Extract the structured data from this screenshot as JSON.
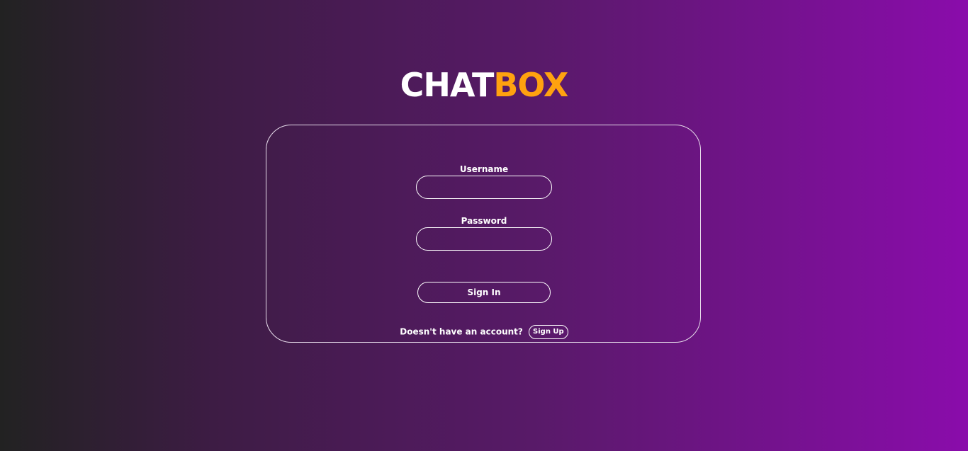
{
  "logo": {
    "part1": "CHAT",
    "part2": "BOX"
  },
  "colors": {
    "accent": "#ffa20f",
    "gradient_start": "#222222",
    "gradient_end": "#8a0cab"
  },
  "form": {
    "username_label": "Username",
    "username_value": "",
    "password_label": "Password",
    "password_value": "",
    "signin_label": "Sign In",
    "signup_prompt": "Doesn't have an account?",
    "signup_label": "Sign Up"
  }
}
